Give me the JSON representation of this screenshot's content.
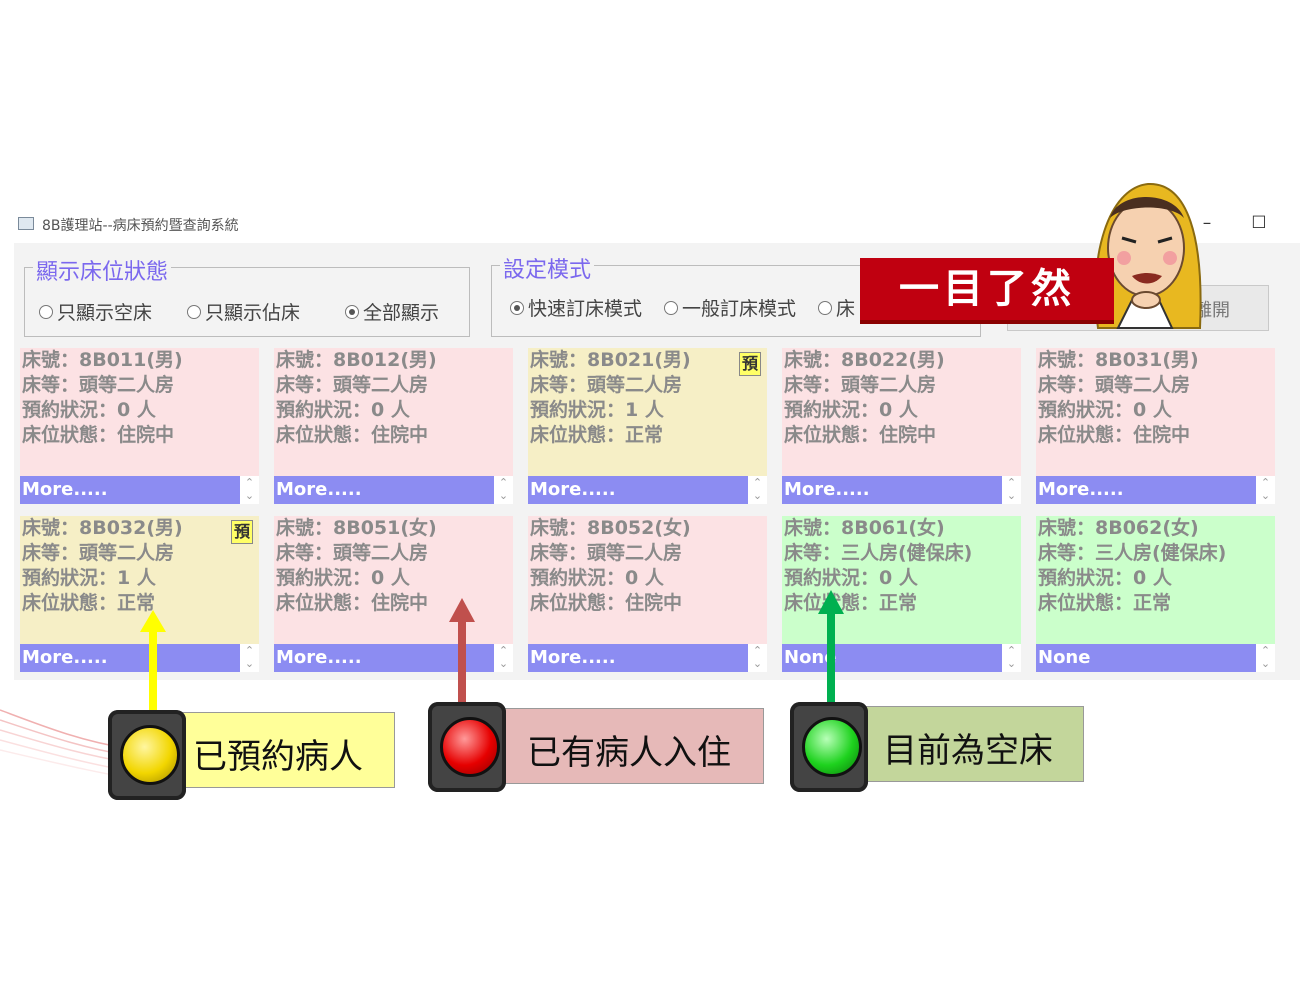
{
  "window": {
    "title": "8B護理站--病床預約暨查詢系統",
    "minimize_glyph": "–",
    "maximize_glyph": "☐"
  },
  "display_group": {
    "legend": "顯示床位狀態",
    "options": [
      {
        "label": "只顯示空床",
        "selected": false
      },
      {
        "label": "只顯示佔床",
        "selected": false
      },
      {
        "label": "全部顯示",
        "selected": true
      }
    ]
  },
  "mode_group": {
    "legend": "設定模式",
    "options": [
      {
        "label": "快速訂床模式",
        "selected": true
      },
      {
        "label": "一般訂床模式",
        "selected": false
      },
      {
        "label": "床",
        "selected": false
      }
    ]
  },
  "exit_button": {
    "label": "離開"
  },
  "callout": {
    "text": "一目了然"
  },
  "beds": [
    {
      "bed_no": "床號：8B011(男)",
      "grade": "床等：頭等二人房",
      "reservation": "預約狀況：0 人",
      "status": "床位狀態：住院中",
      "more": "More.....",
      "color": "pink",
      "reserved": false
    },
    {
      "bed_no": "床號：8B012(男)",
      "grade": "床等：頭等二人房",
      "reservation": "預約狀況：0 人",
      "status": "床位狀態：住院中",
      "more": "More.....",
      "color": "pink",
      "reserved": false
    },
    {
      "bed_no": "床號：8B021(男)",
      "grade": "床等：頭等二人房",
      "reservation": "預約狀況：1 人",
      "status": "床位狀態：正常",
      "more": "More.....",
      "color": "yellow",
      "reserved": true
    },
    {
      "bed_no": "床號：8B022(男)",
      "grade": "床等：頭等二人房",
      "reservation": "預約狀況：0 人",
      "status": "床位狀態：住院中",
      "more": "More.....",
      "color": "pink",
      "reserved": false
    },
    {
      "bed_no": "床號：8B031(男)",
      "grade": "床等：頭等二人房",
      "reservation": "預約狀況：0 人",
      "status": "床位狀態：住院中",
      "more": "More.....",
      "color": "pink",
      "reserved": false
    },
    {
      "bed_no": "床號：8B032(男)",
      "grade": "床等：頭等二人房",
      "reservation": "預約狀況：1 人",
      "status": "床位狀態：正常",
      "more": "More.....",
      "color": "yellow",
      "reserved": true
    },
    {
      "bed_no": "床號：8B051(女)",
      "grade": "床等：頭等二人房",
      "reservation": "預約狀況：0 人",
      "status": "床位狀態：住院中",
      "more": "More.....",
      "color": "pink",
      "reserved": false
    },
    {
      "bed_no": "床號：8B052(女)",
      "grade": "床等：頭等二人房",
      "reservation": "預約狀況：0 人",
      "status": "床位狀態：住院中",
      "more": "More.....",
      "color": "pink",
      "reserved": false
    },
    {
      "bed_no": "床號：8B061(女)",
      "grade": "床等：三人房(健保床)",
      "reservation": "預約狀況：0 人",
      "status": "床位狀態：正常",
      "more": "None",
      "color": "green",
      "reserved": false
    },
    {
      "bed_no": "床號：8B062(女)",
      "grade": "床等：三人房(健保床)",
      "reservation": "預約狀況：0 人",
      "status": "床位狀態：正常",
      "more": "None",
      "color": "green",
      "reserved": false
    }
  ],
  "reserved_badge": "預",
  "legend_items": [
    {
      "label": "已預約病人",
      "light_color": "#f2d600",
      "box_color": "#ffff99",
      "arrow_color": "#ffff00"
    },
    {
      "label": "已有病人入住",
      "light_color": "#e60000",
      "box_color": "#e6b9b8",
      "arrow_color": "#c0504d"
    },
    {
      "label": "目前為空床",
      "light_color": "#1ed21e",
      "box_color": "#c3d69b",
      "arrow_color": "#00b050"
    }
  ]
}
